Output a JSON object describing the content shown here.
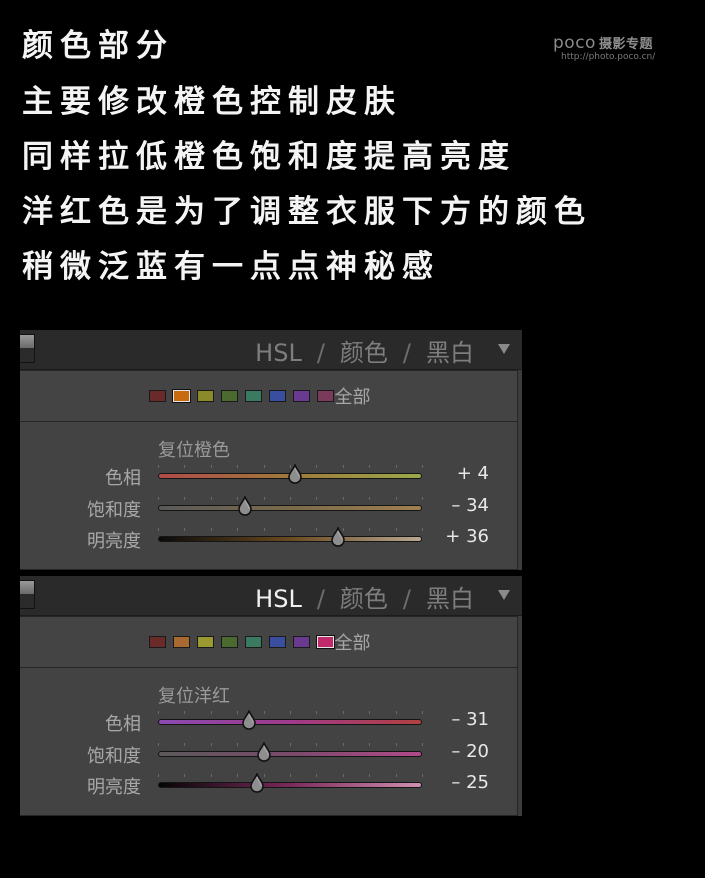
{
  "captions": [
    "颜色部分",
    "主要修改橙色控制皮肤",
    "同样拉低橙色饱和度提高亮度",
    "洋红色是为了调整衣服下方的颜色",
    "稍微泛蓝有一点点神秘感"
  ],
  "watermark": {
    "brand": "poco",
    "brand_cn": "摄影专题",
    "url": "http://photo.poco.cn/"
  },
  "panels": [
    {
      "tabs": [
        {
          "label": "HSL",
          "active": false
        },
        {
          "label": "颜色",
          "active": false
        },
        {
          "label": "黑白",
          "active": false
        }
      ],
      "separator": "/",
      "swatches": [
        "#6a2a2a",
        "#c86a10",
        "#8a8a2a",
        "#4a6a30",
        "#3a7a60",
        "#3a4ea0",
        "#6a3a90",
        "#7a3a5a"
      ],
      "selected_swatch": 1,
      "all_label": "全部",
      "reset_label": "复位橙色",
      "sliders": [
        {
          "label": "色相",
          "value": 4,
          "display": "+ 4",
          "gradient": [
            "#b24a4a",
            "#a07a3a",
            "#9aa84a"
          ]
        },
        {
          "label": "饱和度",
          "value": -34,
          "display": "– 34",
          "gradient": [
            "#5a5a5a",
            "#7a6a4a",
            "#a08050"
          ]
        },
        {
          "label": "明亮度",
          "value": 36,
          "display": "+ 36",
          "gradient": [
            "#0a0a0a",
            "#6a4a20",
            "#b8a890"
          ]
        }
      ]
    },
    {
      "tabs": [
        {
          "label": "HSL",
          "active": true
        },
        {
          "label": "颜色",
          "active": false
        },
        {
          "label": "黑白",
          "active": false
        }
      ],
      "separator": "/",
      "swatches": [
        "#6a2a2a",
        "#a86a30",
        "#9a9a30",
        "#4a6a30",
        "#3a7a60",
        "#3a4ea0",
        "#6a3a90",
        "#c02a6a"
      ],
      "selected_swatch": 7,
      "all_label": "全部",
      "reset_label": "复位洋红",
      "sliders": [
        {
          "label": "色相",
          "value": -31,
          "display": "– 31",
          "gradient": [
            "#8a4ab0",
            "#a03a8a",
            "#b04040"
          ]
        },
        {
          "label": "饱和度",
          "value": -20,
          "display": "– 20",
          "gradient": [
            "#5a5a5a",
            "#7a4a6a",
            "#b04a8a"
          ]
        },
        {
          "label": "明亮度",
          "value": -25,
          "display": "– 25",
          "gradient": [
            "#050505",
            "#7a2a5a",
            "#d090b0"
          ]
        }
      ]
    }
  ]
}
